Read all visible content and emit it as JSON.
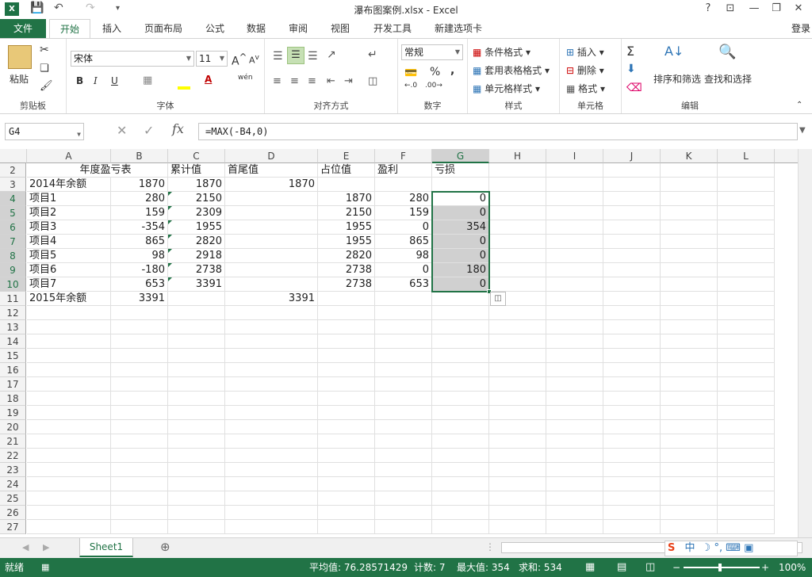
{
  "window": {
    "app_icon": "X",
    "title": "瀑布图案例.xlsx - Excel",
    "help": "?",
    "buttons": [
      "?",
      "⊡",
      "—",
      "❐",
      "✕"
    ]
  },
  "ribbon_tabs": [
    "文件",
    "开始",
    "插入",
    "页面布局",
    "公式",
    "数据",
    "审阅",
    "视图",
    "开发工具",
    "新建选项卡"
  ],
  "active_tab": "开始",
  "login": "登录",
  "ribbon": {
    "clipboard": {
      "paste": "粘贴",
      "label": "剪贴板"
    },
    "font": {
      "name": "宋体",
      "size": "11",
      "bold": "B",
      "italic": "I",
      "underline": "U",
      "label": "字体",
      "wen": "wén"
    },
    "alignment": {
      "label": "对齐方式"
    },
    "number": {
      "format": "常规",
      "percent": "%",
      "comma": ",",
      "label": "数字"
    },
    "styles": {
      "conditional": "条件格式",
      "table": "套用表格格式",
      "cell_styles": "单元格样式",
      "label": "样式"
    },
    "cells": {
      "insert": "插入",
      "delete": "删除",
      "format": "格式",
      "label": "单元格"
    },
    "editing": {
      "sort": "排序和筛选",
      "find": "查找和选择",
      "label": "编辑"
    }
  },
  "formula_bar": {
    "name_box": "G4",
    "fx": "fx",
    "formula": "=MAX(-B4,0)"
  },
  "columns": [
    "A",
    "B",
    "C",
    "D",
    "E",
    "F",
    "G",
    "H",
    "I",
    "J",
    "K",
    "L"
  ],
  "selected_column": "G",
  "rows": [
    {
      "n": "2",
      "cells": {
        "A": "年度盈亏表",
        "C": "累计值",
        "D": "首尾值",
        "E": "占位值",
        "F": "盈利",
        "G": "亏损"
      }
    },
    {
      "n": "3",
      "cells": {
        "A": "2014年余额",
        "B": "1870",
        "C": "1870",
        "D": "1870"
      }
    },
    {
      "n": "4",
      "cells": {
        "A": "项目1",
        "B": "280",
        "C": "2150",
        "E": "1870",
        "F": "280",
        "G": "0"
      }
    },
    {
      "n": "5",
      "cells": {
        "A": "项目2",
        "B": "159",
        "C": "2309",
        "E": "2150",
        "F": "159",
        "G": "0"
      }
    },
    {
      "n": "6",
      "cells": {
        "A": "项目3",
        "B": "-354",
        "C": "1955",
        "E": "1955",
        "F": "0",
        "G": "354"
      }
    },
    {
      "n": "7",
      "cells": {
        "A": "项目4",
        "B": "865",
        "C": "2820",
        "E": "1955",
        "F": "865",
        "G": "0"
      }
    },
    {
      "n": "8",
      "cells": {
        "A": "项目5",
        "B": "98",
        "C": "2918",
        "E": "2820",
        "F": "98",
        "G": "0"
      }
    },
    {
      "n": "9",
      "cells": {
        "A": "项目6",
        "B": "-180",
        "C": "2738",
        "E": "2738",
        "F": "0",
        "G": "180"
      }
    },
    {
      "n": "10",
      "cells": {
        "A": "项目7",
        "B": "653",
        "C": "3391",
        "E": "2738",
        "F": "653",
        "G": "0"
      }
    },
    {
      "n": "11",
      "cells": {
        "A": "2015年余额",
        "B": "3391",
        "D": "3391"
      }
    },
    {
      "n": "12",
      "cells": {}
    },
    {
      "n": "13",
      "cells": {}
    },
    {
      "n": "14",
      "cells": {}
    },
    {
      "n": "15",
      "cells": {}
    },
    {
      "n": "16",
      "cells": {}
    },
    {
      "n": "17",
      "cells": {}
    },
    {
      "n": "18",
      "cells": {}
    },
    {
      "n": "19",
      "cells": {}
    },
    {
      "n": "20",
      "cells": {}
    },
    {
      "n": "21",
      "cells": {}
    },
    {
      "n": "22",
      "cells": {}
    },
    {
      "n": "23",
      "cells": {}
    },
    {
      "n": "24",
      "cells": {}
    },
    {
      "n": "25",
      "cells": {}
    },
    {
      "n": "26",
      "cells": {}
    },
    {
      "n": "27",
      "cells": {}
    }
  ],
  "sheet_tab": "Sheet1",
  "status": {
    "ready": "就绪",
    "average": "平均值: 76.28571429",
    "count": "计数: 7",
    "max": "最大值: 354",
    "sum": "求和: 534",
    "zoom": "100%"
  },
  "ime": {
    "lang": "中"
  },
  "colors": {
    "accent": "#217346",
    "selection": "#d0d0d0"
  }
}
